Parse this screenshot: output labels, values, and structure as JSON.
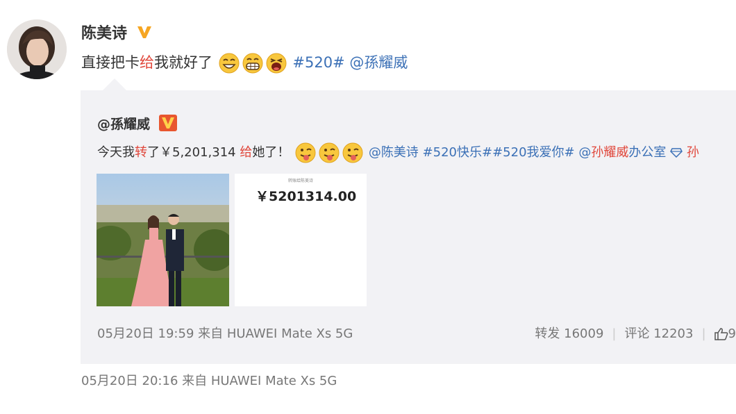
{
  "post": {
    "author": "陈美诗",
    "text_part1": "直接把卡",
    "text_highlight": "给",
    "text_part2": "我就好了",
    "hashtag": "#520#",
    "mention": "@孫耀威",
    "emojis": [
      "grin-emoji",
      "teeth-emoji",
      "laugh-emoji"
    ],
    "meta": "05月20日 20:16  来自 HUAWEI Mate Xs 5G"
  },
  "repost": {
    "author": "@孫耀威",
    "text_part1": "今天我",
    "text_highlight1": "转",
    "text_part2": "了￥5,201,314 ",
    "text_highlight2": "给",
    "text_part3": "她了！",
    "mention1": "@陈美诗",
    "hashtag1": "#520快乐#",
    "hashtag2": "#520我爱你#",
    "mention2_at": "@",
    "mention2_red": "孙耀威",
    "mention2_rest": "办公室",
    "trailing_red": "孙",
    "receipt_header": "转账给陈美诗",
    "receipt_amount": "￥5201314.00",
    "meta": "05月20日 19:59  来自 HUAWEI Mate Xs 5G",
    "forward_label": "转发 16009",
    "comment_label": "评论 12203",
    "like_label": "9"
  },
  "colors": {
    "link": "#3b70b6",
    "highlight": "#e0463a",
    "repost_bg": "#f2f2f5",
    "vbadge": "#f6a623"
  }
}
